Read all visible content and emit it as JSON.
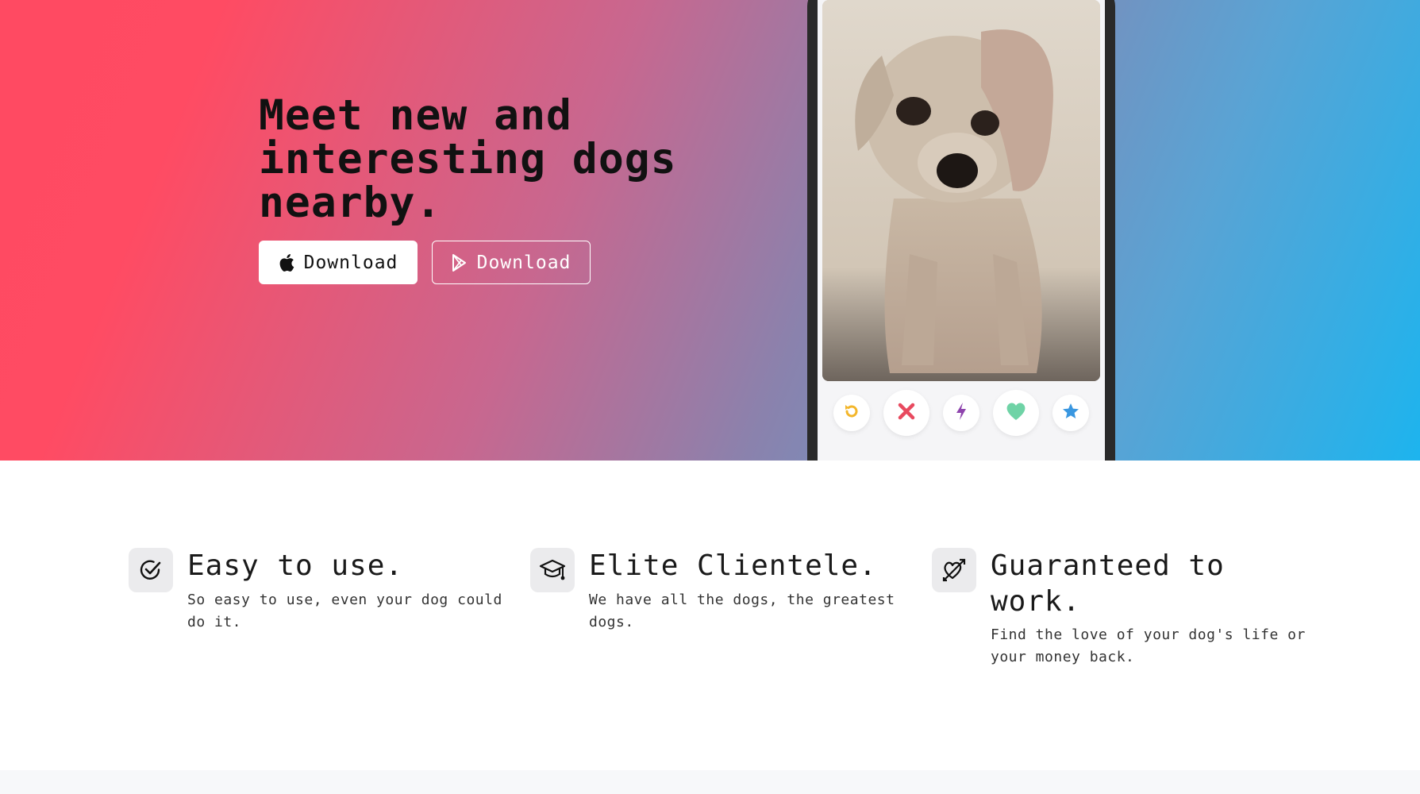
{
  "hero": {
    "title_line1": "Meet new and",
    "title_line2": "interesting dogs",
    "title_line3": "nearby.",
    "apple_button": {
      "label": "Download",
      "icon": "apple-icon"
    },
    "play_button": {
      "label": "Download",
      "icon": "play-store-icon"
    }
  },
  "phone": {
    "photo_alt": "dog-photo",
    "actions": [
      {
        "icon": "rewind-icon",
        "color": "#f3b62b"
      },
      {
        "icon": "close-icon",
        "color": "#e84a5f"
      },
      {
        "icon": "bolt-icon",
        "color": "#8e44ad"
      },
      {
        "icon": "heart-icon",
        "color": "#6fd3a6"
      },
      {
        "icon": "star-icon",
        "color": "#3a97e0"
      }
    ]
  },
  "features": [
    {
      "icon": "check-circle-icon",
      "title": "Easy to use.",
      "text": "So easy to use, even your dog could do it."
    },
    {
      "icon": "graduation-cap-icon",
      "title": "Elite Clientele.",
      "text": "We have all the dogs, the greatest dogs."
    },
    {
      "icon": "heart-arrow-icon",
      "title": "Guaranteed to work.",
      "text": "Find the love of your dog's life or your money back."
    }
  ],
  "colors": {
    "gradient_start": "#ff4a62",
    "gradient_end": "#1db4ee"
  }
}
